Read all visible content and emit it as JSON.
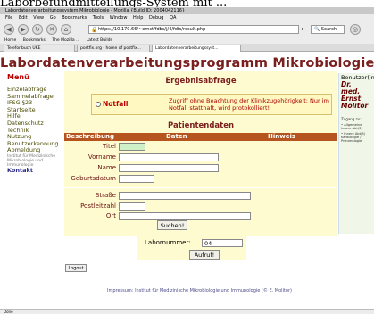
{
  "headline": "Laborbefundmitteilungs-System mit ...",
  "browser": {
    "window_title": "Labordatenverarbeitungssystem Mikrobiologie - Mozilla {Build ID: 2004042116}",
    "menu": [
      "File",
      "Edit",
      "View",
      "Go",
      "Bookmarks",
      "Tools",
      "Window",
      "Help",
      "Debug",
      "QA"
    ],
    "url": "https://10.170.66/~ernst/fdbs/j/4/fdfs/result.php",
    "search_label": "Search",
    "bookmarks": [
      "Home",
      "Bookmarks",
      "The Mozilla ...",
      "Latest Builds"
    ],
    "tabs": [
      "Telefonbuch UKE",
      "postfix.org - home of postfix...",
      "Labordatenverarbeitungssyst..."
    ]
  },
  "app_title": "Labordatenverarbeitungsprogramm Mikrobiologie",
  "sidebar": {
    "title": "Menü",
    "items": [
      {
        "label": "Einzelabfrage",
        "style": "normal"
      },
      {
        "label": "Sammelabfrage",
        "style": "normal"
      },
      {
        "label": "IFSG §23",
        "style": "normal"
      },
      {
        "label": "Startseite",
        "style": "normal"
      },
      {
        "label": "Hilfe",
        "style": "normal"
      },
      {
        "label": "Datenschutz",
        "style": "normal"
      },
      {
        "label": "Technik",
        "style": "normal"
      },
      {
        "label": "Nutzung",
        "style": "normal"
      },
      {
        "label": "Benutzerkennung",
        "style": "normal"
      },
      {
        "label": "Abmeldung",
        "style": "normal"
      },
      {
        "label": "Institut für Medizinische",
        "style": "small"
      },
      {
        "label": "Mikrobiologie und",
        "style": "small"
      },
      {
        "label": "Immunologie",
        "style": "small"
      },
      {
        "label": "Kontakt",
        "style": "bold"
      }
    ]
  },
  "user_panel": {
    "label": "Benutzer(in):",
    "name_lines": [
      "Dr. med.",
      "Ernst",
      "Molitor"
    ],
    "access_label": "Zugang zu:",
    "access_items": [
      "Allgemeine Innere Abt(3)",
      "Innere Abt(3) Kardiologie / Pneumologie"
    ]
  },
  "main": {
    "section_title": "Ergebnisabfrage",
    "notfall_label": "Notfall",
    "notfall_text": "Zugriff ohne Beachtung der Klinikzugehörigkeit: Nur im Notfall statthaft, wird protokolliert!",
    "patient_title": "Patientendaten",
    "headers": {
      "col1": "Beschreibung",
      "col2": "Daten",
      "col3": "Hinweis"
    },
    "fields": [
      {
        "label": "Titel",
        "value": ""
      },
      {
        "label": "Vorname",
        "value": ""
      },
      {
        "label": "Name",
        "value": ""
      },
      {
        "label": "Geburtsdatum",
        "value": ""
      },
      {
        "label": "Straße",
        "value": ""
      },
      {
        "label": "Postleitzahl",
        "value": ""
      },
      {
        "label": "Ort",
        "value": ""
      }
    ],
    "search_button": "Suchen!"
  },
  "labnum": {
    "label": "Labornummer:",
    "value": "04-",
    "button": "Aufruf!"
  },
  "logout": "Logout",
  "impressum": "Impressum: Institut für Medizinische Mikrobiologie und Immunologie (© E. Molitor)",
  "status": "Done"
}
